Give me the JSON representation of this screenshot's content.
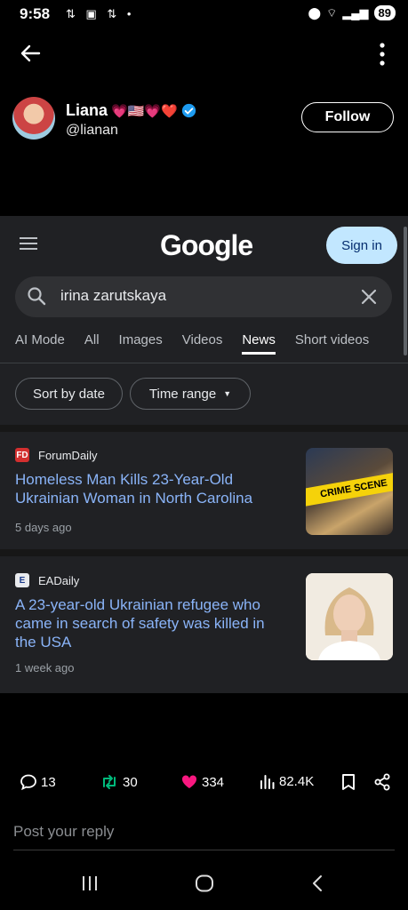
{
  "status_bar": {
    "time": "9:58",
    "battery": "89"
  },
  "profile": {
    "name": "Liana",
    "emoji_flags": "💗🇺🇸💗❤️",
    "handle": "@lianan",
    "follow_label": "Follow"
  },
  "google": {
    "logo": "Google",
    "sign_in_label": "Sign in",
    "search_value": "irina zarutskaya",
    "tabs": [
      {
        "label": "AI Mode"
      },
      {
        "label": "All"
      },
      {
        "label": "Images"
      },
      {
        "label": "Videos"
      },
      {
        "label": "News",
        "active": true
      },
      {
        "label": "Short videos"
      }
    ],
    "chips": [
      {
        "label": "Sort by date"
      },
      {
        "label": "Time range"
      }
    ],
    "results": [
      {
        "source": "ForumDaily",
        "source_icon": "FD",
        "headline": "Homeless Man Kills 23-Year-Old Ukrainian Woman in North Carolina",
        "time": "5 days ago",
        "thumb_text": "CRIME SCENE"
      },
      {
        "source": "EADaily",
        "source_icon": "E",
        "headline": "A 23-year-old Ukrainian refugee who came in search of safety was killed in the USA",
        "time": "1 week ago"
      }
    ]
  },
  "tweet_actions": {
    "replies": "13",
    "retweets": "30",
    "likes": "334",
    "views": "82.4K"
  },
  "reply_placeholder": "Post your reply",
  "colors": {
    "accent_blue": "#8ab4f8",
    "retweet_green": "#00ba7c",
    "like_pink": "#f91880",
    "verified": "#1d9bf0"
  }
}
